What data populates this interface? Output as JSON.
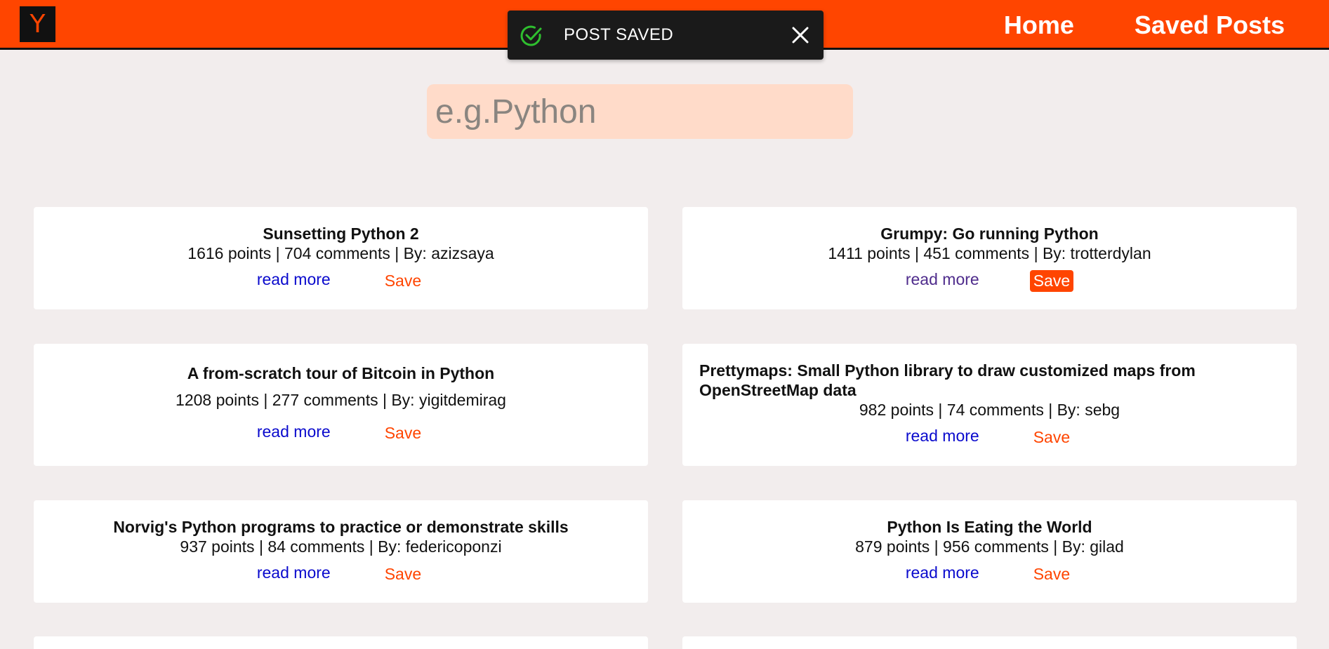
{
  "header": {
    "logo_letter": "Y",
    "nav": {
      "home": "Home",
      "saved_posts": "Saved Posts"
    }
  },
  "toast": {
    "message": "POST SAVED"
  },
  "search": {
    "placeholder": "e.g.Python",
    "value": ""
  },
  "cards": [
    {
      "title": "Sunsetting Python 2",
      "meta": "1616 points | 704 comments | By: azizsaya",
      "read": "read more",
      "save": "Save"
    },
    {
      "title": "Grumpy: Go running Python",
      "meta": "1411 points | 451 comments | By: trotterdylan",
      "read": "read more",
      "save": "Save"
    },
    {
      "title": "A from-scratch tour of Bitcoin in Python",
      "meta": "1208 points | 277 comments | By: yigitdemirag",
      "read": "read more",
      "save": "Save"
    },
    {
      "title": "Prettymaps: Small Python library to draw customized maps from OpenStreetMap data",
      "meta": "982 points | 74 comments | By: sebg",
      "read": "read more",
      "save": "Save"
    },
    {
      "title": "Norvig's Python programs to practice or demonstrate skills",
      "meta": "937 points | 84 comments | By: federicoponzi",
      "read": "read more",
      "save": "Save"
    },
    {
      "title": "Python Is Eating the World",
      "meta": "879 points | 956 comments | By: gilad",
      "read": "read more",
      "save": "Save"
    }
  ],
  "colors": {
    "brand": "#ff4500",
    "background": "#f2eded",
    "search_bg": "#ffdbc9",
    "toast_bg": "#1a1a1a",
    "link": "#0a0acd",
    "visited_link": "#4f2c8c"
  }
}
